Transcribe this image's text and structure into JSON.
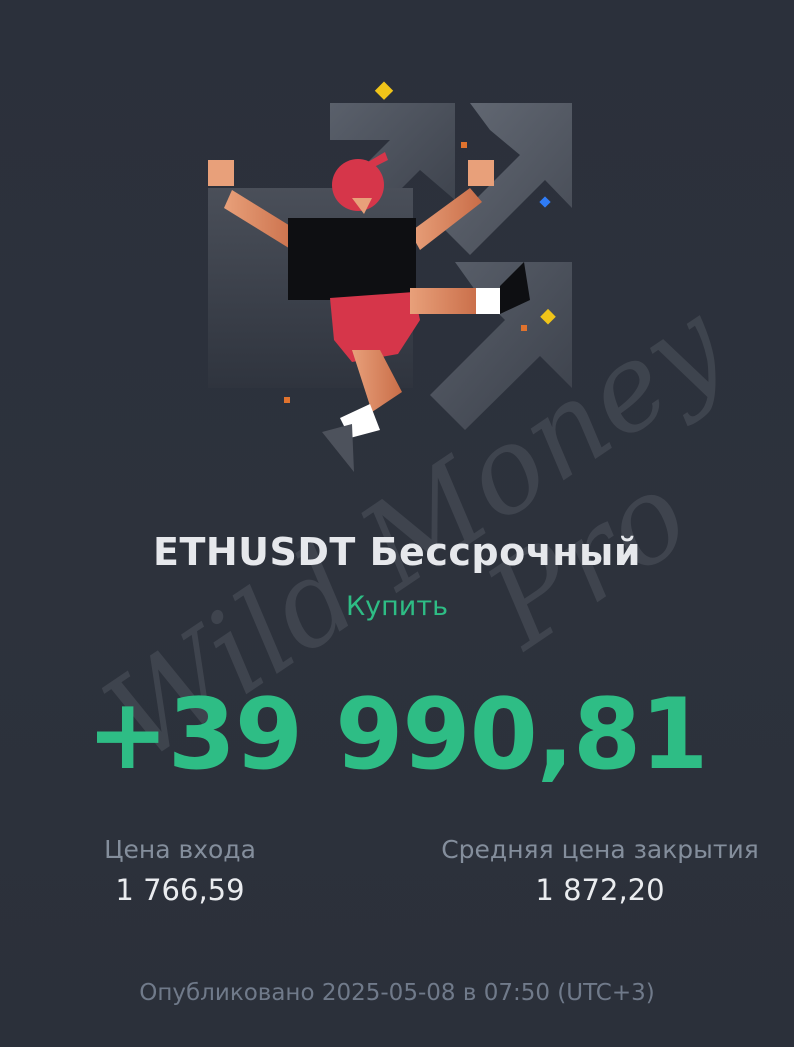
{
  "header": {
    "title": "ETHUSDT Бессрочный",
    "side": "Купить"
  },
  "pnl": {
    "value": "+39 990,81"
  },
  "stats": {
    "entry_label": "Цена входа",
    "entry_value": "1 766,59",
    "close_label": "Средняя цена закрытия",
    "close_value": "1 872,20"
  },
  "footer": {
    "published": "Опубликовано 2025-05-08 в 07:50 (UTC+3)"
  },
  "watermark": {
    "line1": "Wild Money",
    "line2": "Pro"
  },
  "colors": {
    "background": "#2b303b",
    "accent_green": "#2ebd85",
    "label_grey": "#848e9c",
    "value_white": "#eaecef"
  },
  "icons": {
    "illustration": "jumping-trader-with-up-arrows"
  }
}
